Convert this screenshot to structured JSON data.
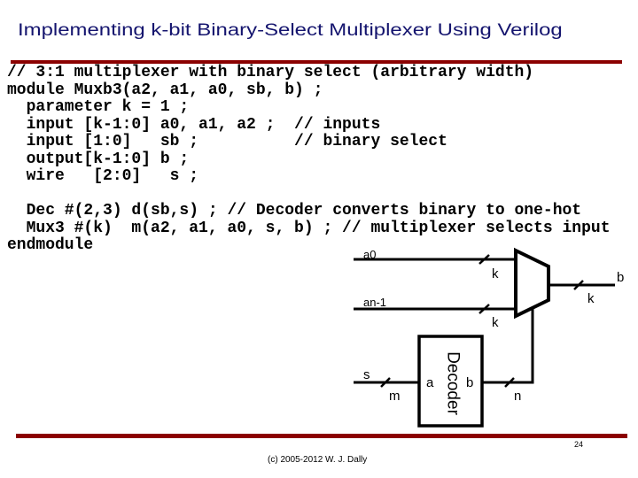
{
  "slide": {
    "title": "Implementing k-bit Binary-Select Multiplexer Using Verilog",
    "footer": "(c) 2005-2012 W. J. Dally",
    "page_number": "24"
  },
  "code": {
    "lines": [
      "// 3:1 multiplexer with binary select (arbitrary width)",
      "module Muxb3(a2, a1, a0, sb, b) ;",
      "  parameter k = 1 ;",
      "  input [k-1:0] a0, a1, a2 ;  // inputs",
      "  input [1:0]   sb ;          // binary select",
      "  output[k-1:0] b ;",
      "  wire   [2:0]   s ;",
      "",
      "  Dec #(2,3) d(sb,s) ; // Decoder converts binary to one-hot",
      "  Mux3 #(k)  m(a2, a1, a0, s, b) ; // multiplexer selects input",
      "endmodule"
    ]
  },
  "diagram": {
    "mux": {
      "inputs": [
        {
          "label": "a0",
          "width": "k"
        },
        {
          "label": "an-1",
          "width": "k"
        }
      ],
      "output": {
        "label": "b",
        "width": "k"
      }
    },
    "decoder": {
      "title": "Decoder",
      "input_port": "a",
      "output_port": "b",
      "input_signal": "s",
      "input_width": "m",
      "output_width": "n"
    }
  },
  "colors": {
    "title": "#14146e",
    "rule": "#8b0000"
  }
}
